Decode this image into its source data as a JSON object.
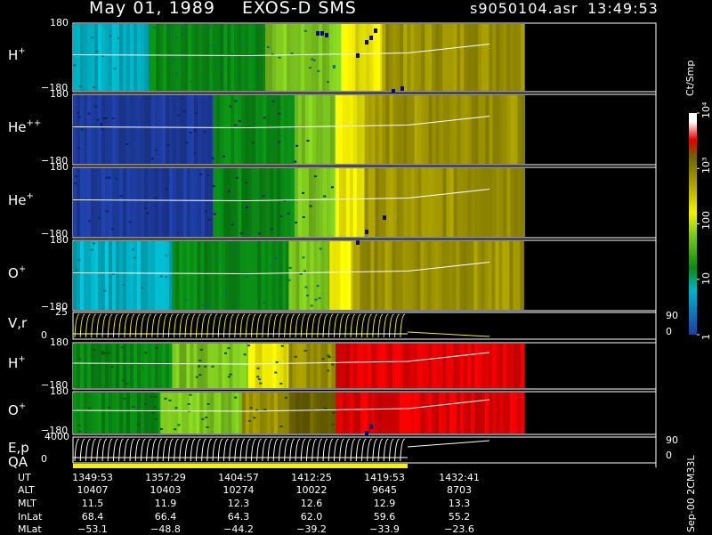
{
  "header": {
    "date": "May 01, 1989",
    "instrument": "EXOS-D SMS",
    "file": "s9050104.asr",
    "time": "13:49:53"
  },
  "colors": {
    "cyan": "#00b4c8",
    "blue": "#1e3ca0",
    "green": "#0a8a14",
    "lime": "#7ec81e",
    "yellow": "#f5f000",
    "olive": "#a09600",
    "darkolive": "#6e6400",
    "red": "#e60000",
    "white": "#ffffff",
    "navy": "#0a0a82"
  },
  "chart_data": {
    "type": "heatmap",
    "time_range": [
      "1349:53",
      "1432:41"
    ],
    "data_coverage_end": "1427:00",
    "panels": [
      {
        "id": "hplus",
        "species": "H",
        "charge": "+",
        "ylabels": [
          "180",
          "−180"
        ],
        "ylim": [
          -180,
          180
        ],
        "color_segments": [
          {
            "t0": 0.0,
            "t1": 0.13,
            "color": "cyan"
          },
          {
            "t0": 0.13,
            "t1": 0.33,
            "color": "green"
          },
          {
            "t0": 0.33,
            "t1": 0.46,
            "color": "lime"
          },
          {
            "t0": 0.46,
            "t1": 0.53,
            "color": "yellow"
          },
          {
            "t0": 0.53,
            "t1": 0.77,
            "color": "olive"
          }
        ]
      },
      {
        "id": "heplusplus",
        "species": "He",
        "charge": "++",
        "ylabels": [
          "180",
          "−180"
        ],
        "ylim": [
          -180,
          180
        ],
        "color_segments": [
          {
            "t0": 0.0,
            "t1": 0.24,
            "color": "blue"
          },
          {
            "t0": 0.24,
            "t1": 0.38,
            "color": "green"
          },
          {
            "t0": 0.38,
            "t1": 0.45,
            "color": "lime"
          },
          {
            "t0": 0.45,
            "t1": 0.5,
            "color": "yellow"
          },
          {
            "t0": 0.5,
            "t1": 0.77,
            "color": "olive"
          }
        ]
      },
      {
        "id": "heplus",
        "species": "He",
        "charge": "+",
        "ylabels": [
          "180",
          "−180"
        ],
        "ylim": [
          -180,
          180
        ],
        "color_segments": [
          {
            "t0": 0.0,
            "t1": 0.24,
            "color": "blue"
          },
          {
            "t0": 0.24,
            "t1": 0.38,
            "color": "green"
          },
          {
            "t0": 0.38,
            "t1": 0.45,
            "color": "lime"
          },
          {
            "t0": 0.45,
            "t1": 0.5,
            "color": "yellow"
          },
          {
            "t0": 0.5,
            "t1": 0.77,
            "color": "olive"
          }
        ]
      },
      {
        "id": "oplus",
        "species": "O",
        "charge": "+",
        "ylabels": [
          "180",
          "−180"
        ],
        "ylim": [
          -180,
          180
        ],
        "color_segments": [
          {
            "t0": 0.0,
            "t1": 0.17,
            "color": "cyan"
          },
          {
            "t0": 0.17,
            "t1": 0.37,
            "color": "green"
          },
          {
            "t0": 0.37,
            "t1": 0.44,
            "color": "lime"
          },
          {
            "t0": 0.44,
            "t1": 0.48,
            "color": "yellow"
          },
          {
            "t0": 0.48,
            "t1": 0.77,
            "color": "olive"
          }
        ]
      },
      {
        "id": "vr",
        "label": "V,r",
        "ylabels": [
          "25",
          "0"
        ],
        "right_labels": [
          "90",
          "0"
        ],
        "ylim": [
          0,
          25
        ]
      },
      {
        "id": "hplus2",
        "species": "H",
        "charge": "+",
        "ylabels": [
          "180",
          "−180"
        ],
        "ylim": [
          -180,
          180
        ],
        "color_segments": [
          {
            "t0": 0.0,
            "t1": 0.17,
            "color": "green"
          },
          {
            "t0": 0.17,
            "t1": 0.3,
            "color": "lime"
          },
          {
            "t0": 0.3,
            "t1": 0.37,
            "color": "yellow"
          },
          {
            "t0": 0.37,
            "t1": 0.45,
            "color": "olive"
          },
          {
            "t0": 0.45,
            "t1": 0.77,
            "color": "red"
          }
        ]
      },
      {
        "id": "oplus2",
        "species": "O",
        "charge": "+",
        "ylabels": [
          "180",
          "−180"
        ],
        "ylim": [
          -180,
          180
        ],
        "color_segments": [
          {
            "t0": 0.0,
            "t1": 0.15,
            "color": "green"
          },
          {
            "t0": 0.15,
            "t1": 0.29,
            "color": "lime"
          },
          {
            "t0": 0.29,
            "t1": 0.37,
            "color": "olive"
          },
          {
            "t0": 0.37,
            "t1": 0.45,
            "color": "darkolive"
          },
          {
            "t0": 0.45,
            "t1": 0.77,
            "color": "red"
          }
        ]
      },
      {
        "id": "ep",
        "label": "E,p",
        "ylabels": [
          "4000",
          "0"
        ],
        "right_labels": [
          "90",
          "0"
        ],
        "ylim": [
          0,
          4000
        ]
      }
    ],
    "qa_label": "QA",
    "colorbar": {
      "title": "Ct/Smp",
      "scale": "log",
      "ticks": [
        "1",
        "10",
        "100",
        "10³",
        "10⁴"
      ],
      "stops": [
        {
          "frac": 0.0,
          "color": "#1e3ca0"
        },
        {
          "frac": 0.2,
          "color": "#00b4c8"
        },
        {
          "frac": 0.3,
          "color": "#0a8a14"
        },
        {
          "frac": 0.45,
          "color": "#7ec81e"
        },
        {
          "frac": 0.55,
          "color": "#f5f000"
        },
        {
          "frac": 0.7,
          "color": "#a09600"
        },
        {
          "frac": 0.8,
          "color": "#6e6400"
        },
        {
          "frac": 0.88,
          "color": "#e60000"
        },
        {
          "frac": 0.96,
          "color": "#ffffff"
        }
      ]
    },
    "version_label": "Sep-00  2CM33L"
  },
  "ephemeris": {
    "labels": [
      "UT",
      "ALT",
      "MLT",
      "InLat",
      "MLat"
    ],
    "columns": [
      [
        "1349:53",
        "10407",
        "11.5",
        "68.4",
        "−53.1"
      ],
      [
        "1357:29",
        "10403",
        "11.9",
        "66.4",
        "−48.8"
      ],
      [
        "1404:57",
        "10274",
        "12.3",
        "64.3",
        "−44.2"
      ],
      [
        "1412:25",
        "10022",
        "12.6",
        "62.0",
        "−39.2"
      ],
      [
        "1419:53",
        "9645",
        "12.9",
        "59.6",
        "−33.9"
      ],
      [
        "1432:41",
        "8703",
        "13.3",
        "55.2",
        "−23.6"
      ]
    ]
  }
}
